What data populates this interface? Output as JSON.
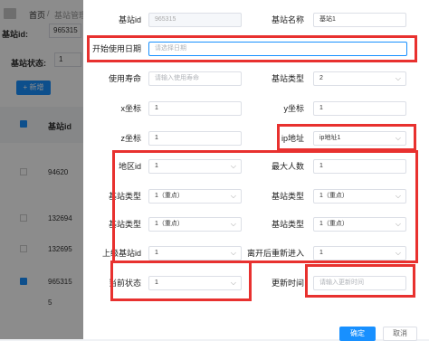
{
  "background": {
    "breadcrumb": [
      "首页",
      "/",
      "基站管理"
    ],
    "filters": {
      "station_id_label": "基站id:",
      "station_id_value": "965315",
      "station_status_label": "基站状态:",
      "station_status_value": "1"
    },
    "add_button": "+ 新增",
    "table_header": "基站id",
    "rows": [
      "94620",
      "132694",
      "132695",
      "965315",
      "5"
    ]
  },
  "form": {
    "station_id": {
      "label": "基站id",
      "value": "965315"
    },
    "station_name": {
      "label": "基站名称",
      "value": "基站1"
    },
    "start_date": {
      "label": "开始使用日期",
      "placeholder": "请选择日期"
    },
    "lifetime": {
      "label": "使用寿命",
      "placeholder": "请输入使用寿命"
    },
    "station_type_top": {
      "label": "基站类型",
      "value": "2"
    },
    "x_coord": {
      "label": "x坐标",
      "value": "1"
    },
    "y_coord": {
      "label": "y坐标",
      "value": "1"
    },
    "z_coord": {
      "label": "z坐标",
      "value": "1"
    },
    "ip_address": {
      "label": "ip地址",
      "value": "ip地址1"
    },
    "region_id": {
      "label": "地区id",
      "value": "1"
    },
    "max_people": {
      "label": "最大人数",
      "value": "1"
    },
    "type_row1_left": {
      "label": "基站类型",
      "value": "1（重点）"
    },
    "type_row1_right": {
      "label": "基站类型",
      "value": "1（重点）"
    },
    "type_row2_left": {
      "label": "基站类型",
      "value": "1（重点）"
    },
    "type_row2_right": {
      "label": "基站类型",
      "value": "1（重点）"
    },
    "parent_station_id": {
      "label": "上级基站id",
      "value": "1"
    },
    "reenter_after_leave": {
      "label": "离开后重新进入",
      "value": "1"
    },
    "current_status": {
      "label": "当前状态",
      "value": "1"
    },
    "update_time": {
      "label": "更新时间",
      "placeholder": "请输入更新时间"
    }
  },
  "buttons": {
    "confirm": "确定",
    "cancel": "取消"
  },
  "colors": {
    "primary": "#1890ff",
    "highlight_border": "#e8312f",
    "mask": "rgba(0,0,0,0.45)"
  }
}
